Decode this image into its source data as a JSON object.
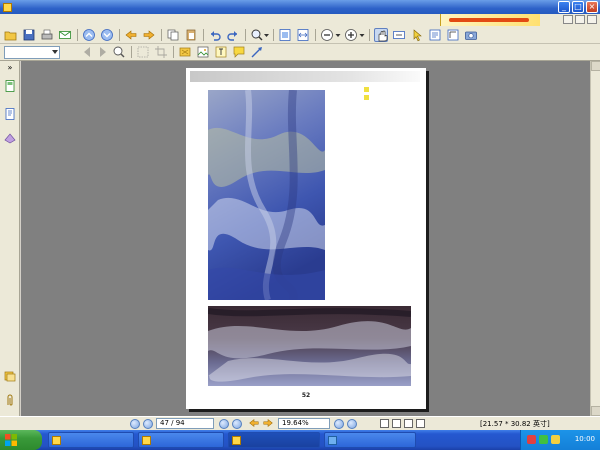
{
  "window": {
    "title": "",
    "controls": [
      "_",
      "□",
      "×"
    ]
  },
  "menu": {
    "items": [
      "",
      "",
      "",
      "",
      "",
      "",
      ""
    ]
  },
  "toolbar": {
    "zoom_in_label": "+",
    "zoom_out_label": "−"
  },
  "search": {
    "placeholder": ""
  },
  "document": {
    "header_title": "",
    "legend": [
      "",
      ""
    ],
    "caption_lines": [
      "",
      "",
      "",
      "",
      "",
      "",
      "",
      ""
    ],
    "page_number": "52"
  },
  "statusbar": {
    "ready_label": "",
    "page_counter": "47 / 94",
    "zoom_level": "19.64%",
    "dimensions": "[21.57 * 30.82 英寸]"
  },
  "taskbar": {
    "start_label": "",
    "tasks": [
      "",
      "",
      "",
      ""
    ],
    "clock": "10:00"
  },
  "colors": {
    "titlebar": "#2e62c8",
    "chrome": "#ece9d8",
    "workspace": "#808080",
    "taskbar": "#2452c4",
    "start": "#3a9a3a"
  }
}
